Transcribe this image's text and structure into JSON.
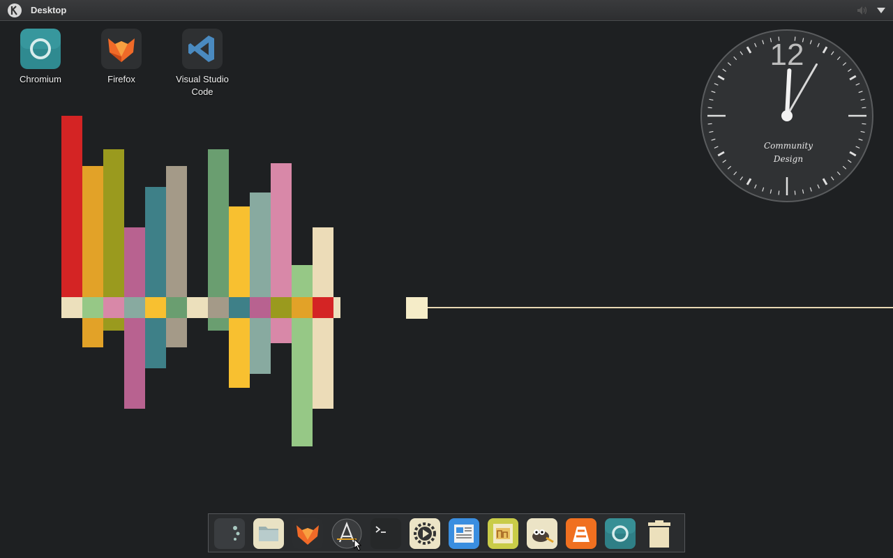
{
  "panel": {
    "title": "Desktop"
  },
  "desktop_icons": [
    {
      "label": "Chromium",
      "icon": "chromium-icon"
    },
    {
      "label": "Firefox",
      "icon": "firefox-icon"
    },
    {
      "label": "Visual Studio Code",
      "icon": "vscode-icon"
    }
  ],
  "clock": {
    "numeral": "12",
    "brand_line1": "Community",
    "brand_line2": "Design",
    "hour_hand_deg": 3,
    "minute_hand_deg": 30
  },
  "visualizer": {
    "bars": [
      {
        "color": "#d42424",
        "up": 260,
        "down": 0
      },
      {
        "color": "#e2a228",
        "up": 188,
        "down": 42
      },
      {
        "color": "#9a9a1e",
        "up": 212,
        "down": 18
      },
      {
        "color": "#b86290",
        "up": 100,
        "down": 130
      },
      {
        "color": "#3e8088",
        "up": 158,
        "down": 72
      },
      {
        "color": "#a49a88",
        "up": 188,
        "down": 42
      },
      {
        "color": "#1e2022",
        "up": 0,
        "down": 0
      },
      {
        "color": "#6a9e70",
        "up": 212,
        "down": 18
      },
      {
        "color": "#f8c030",
        "up": 130,
        "down": 100
      },
      {
        "color": "#88aaa0",
        "up": 150,
        "down": 80
      },
      {
        "color": "#d888a8",
        "up": 192,
        "down": 36
      },
      {
        "color": "#96c886",
        "up": 46,
        "down": 184
      },
      {
        "color": "#ecdcb8",
        "up": 100,
        "down": 130
      }
    ],
    "baseline_colors": [
      "#ece0bc",
      "#96c886",
      "#d888a8",
      "#88aaa0",
      "#f8c030",
      "#6a9e70",
      "#ece0bc",
      "#a49a88",
      "#3e8088",
      "#b86290",
      "#9a9a1e",
      "#e2a228",
      "#d42424",
      "#ece0bc"
    ],
    "accent": "#f5ecc8"
  },
  "dock": [
    {
      "name": "plasma-dock-launcher",
      "icon": "plasma-icon",
      "bg": "#3a3d40"
    },
    {
      "name": "files",
      "icon": "folder-icon",
      "bg": "#e9e2c4"
    },
    {
      "name": "firefox",
      "icon": "firefox-icon",
      "bg": "#2b2d2f"
    },
    {
      "name": "app-store",
      "icon": "store-icon",
      "bg": "#2b2d2f"
    },
    {
      "name": "terminal",
      "icon": "terminal-icon",
      "bg": "#262829"
    },
    {
      "name": "settings",
      "icon": "gear-icon",
      "bg": "#ece4c6"
    },
    {
      "name": "text-editor",
      "icon": "document-icon",
      "bg": "#3a8ee0"
    },
    {
      "name": "image-viewer",
      "icon": "image-icon",
      "bg": "#c9cc48"
    },
    {
      "name": "gimp",
      "icon": "gimp-icon",
      "bg": "#ece4c6"
    },
    {
      "name": "vlc",
      "icon": "vlc-icon",
      "bg": "#f07020"
    },
    {
      "name": "chromium",
      "icon": "chromium-icon",
      "bg": "#2f7f86"
    },
    {
      "name": "trash",
      "icon": "trash-icon",
      "bg": "#ece0bc"
    }
  ]
}
